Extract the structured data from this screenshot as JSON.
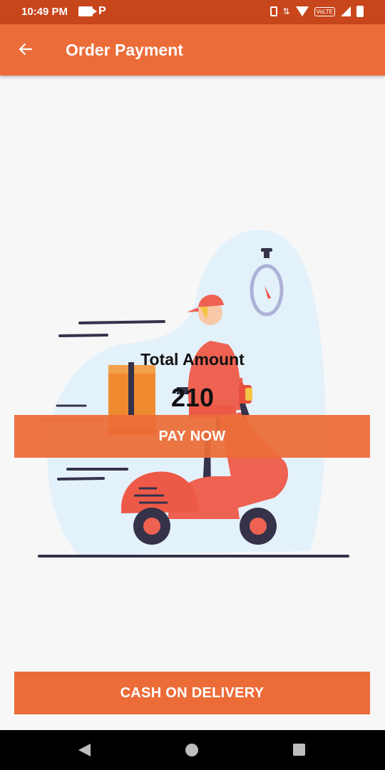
{
  "status_bar": {
    "time": "10:49 PM",
    "volte_label": "VoLTE"
  },
  "app_bar": {
    "title": "Order Payment"
  },
  "payment": {
    "total_label": "Total Amount",
    "total_value": "210"
  },
  "buttons": {
    "pay_now": "PAY NOW",
    "cash_on_delivery": "CASH ON DELIVERY"
  },
  "icons": {
    "back": "arrow-left-icon",
    "status_left": [
      "video-camera-icon",
      "p-app-icon"
    ],
    "status_right": [
      "vibrate-icon",
      "data-arrows-icon",
      "wifi-icon",
      "volte-icon",
      "signal-icon",
      "battery-icon"
    ],
    "nav": [
      "nav-back-icon",
      "nav-home-icon",
      "nav-recents-icon"
    ]
  },
  "colors": {
    "status_bar": "#c8461c",
    "accent": "#ec6c38",
    "background": "#f7f7f7",
    "illustration_blob": "#e3f1fb",
    "scooter": "#ee6252"
  }
}
